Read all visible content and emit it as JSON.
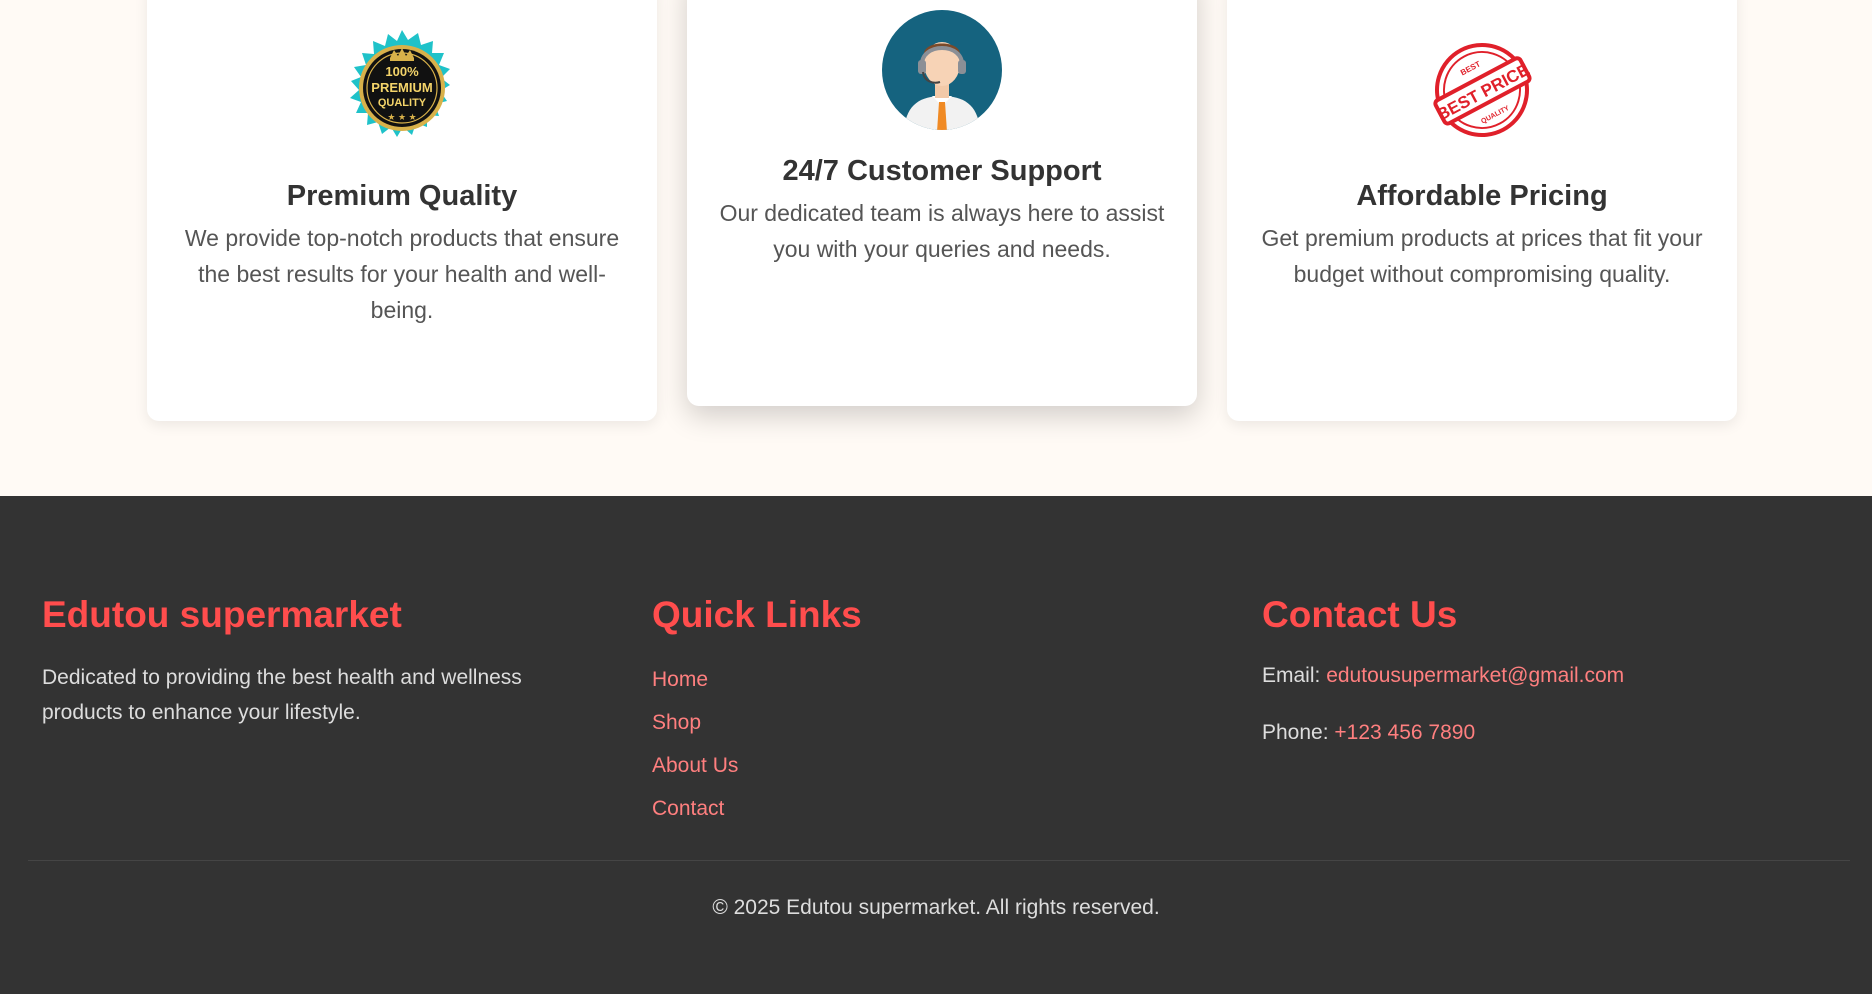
{
  "features": [
    {
      "icon": "premium-quality-badge-icon",
      "badge_text": [
        "100%",
        "PREMIUM",
        "QUALITY"
      ],
      "title": "Premium Quality",
      "description": "We provide top-notch products that ensure the best results for your health and well-being."
    },
    {
      "icon": "customer-support-agent-icon",
      "title": "24/7 Customer Support",
      "description": "Our dedicated team is always here to assist you with your queries and needs."
    },
    {
      "icon": "best-price-stamp-icon",
      "stamp_text": [
        "BEST",
        "BEST PRICE",
        "QUALITY"
      ],
      "title": "Affordable Pricing",
      "description": "Get premium products at prices that fit your budget without compromising quality."
    }
  ],
  "footer": {
    "brand": {
      "title": "Edutou supermarket",
      "description": "Dedicated to providing the best health and wellness products to enhance your lifestyle."
    },
    "quick_links": {
      "title": "Quick Links",
      "items": [
        "Home",
        "Shop",
        "About Us",
        "Contact"
      ]
    },
    "contact": {
      "title": "Contact Us",
      "email_label": "Email:",
      "email": "edutousupermarket@gmail.com",
      "phone_label": "Phone:",
      "phone": "+123 456 7890"
    },
    "copyright": "© 2025 Edutou supermarket. All rights reserved."
  },
  "colors": {
    "accent": "#ff4d4d",
    "link": "#ff7f7f",
    "footer_bg": "#333333",
    "page_bg": "#fffaf5"
  }
}
